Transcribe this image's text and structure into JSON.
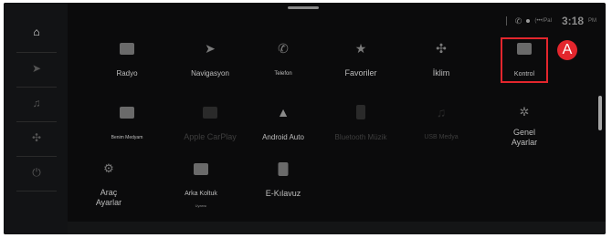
{
  "status": {
    "phone_icon": "phone-icon",
    "network": "(•••/Pal",
    "time": "3:18",
    "ampm": "PM"
  },
  "sidebar": {
    "items": [
      {
        "name": "home",
        "glyph": "⌂",
        "active": true
      },
      {
        "name": "navigation",
        "glyph": "➤",
        "active": false
      },
      {
        "name": "media",
        "glyph": "♫",
        "active": false
      },
      {
        "name": "climate",
        "glyph": "✣",
        "active": false
      },
      {
        "name": "power",
        "glyph": "⏻",
        "active": false
      }
    ]
  },
  "grid": {
    "row1": [
      {
        "label": "Radyo",
        "icon": "radio-icon"
      },
      {
        "label": "Navigasyon",
        "icon": "navigation-icon"
      },
      {
        "label": "Telefon",
        "icon": "phone-icon"
      },
      {
        "label": "Favoriler",
        "icon": "star-icon"
      },
      {
        "label": "İklim",
        "icon": "fan-icon"
      },
      {
        "label": "Kontrol",
        "icon": "control-icon"
      }
    ],
    "row2": [
      {
        "label": "Benim Medyam",
        "icon": "media-icon"
      },
      {
        "label": "Apple CarPlay",
        "icon": "carplay-icon"
      },
      {
        "label": "Android Auto",
        "icon": "android-auto-icon"
      },
      {
        "label": "Bluetooth Müzik",
        "icon": "bluetooth-music-icon"
      },
      {
        "label": "USB Medya",
        "icon": "usb-media-icon"
      },
      {
        "label": "Genel\nAyarlar",
        "icon": "settings-gear-icon"
      }
    ],
    "row3": [
      {
        "label": "Araç\nAyarlar",
        "icon": "car-settings-icon"
      },
      {
        "label": "Arka Koltuk",
        "sublabel": "Uyarısı",
        "icon": "rear-seat-icon"
      },
      {
        "label": "E-Kılavuz",
        "icon": "e-manual-icon"
      }
    ]
  },
  "callout": {
    "label": "A"
  },
  "colors": {
    "accent_red": "#e3262d",
    "background": "#0b0b0c"
  }
}
